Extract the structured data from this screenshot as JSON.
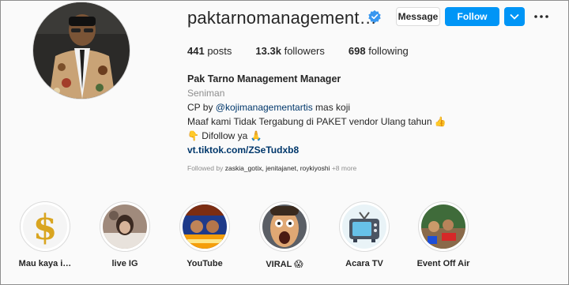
{
  "profile": {
    "username": "paktarnomanagement…",
    "verified_icon": "verified-badge-icon",
    "buttons": {
      "message": "Message",
      "follow": "Follow"
    },
    "stats": {
      "posts_value": "441",
      "posts_label": "posts",
      "followers_value": "13.3k",
      "followers_label": "followers",
      "following_value": "698",
      "following_label": "following"
    },
    "bio": {
      "name": "Pak Tarno Management Manager",
      "category": "Seniman",
      "line1_prefix": "CP by ",
      "line1_mention": "@kojimanagementartis",
      "line1_suffix": " mas koji",
      "line2": "Maaf kami Tidak Tergabung di PAKET vendor Ulang tahun 👍",
      "line3": "👇 Difollow ya 🙏",
      "link": "vt.tiktok.com/ZSeTudxb8"
    },
    "followed_by": {
      "prefix": "Followed by ",
      "users": "zaskia_gotix, jenitajanet, roykiyoshi",
      "suffix": " +8 more"
    }
  },
  "highlights": [
    {
      "label": "Mau kaya i…",
      "icon": "dollar-sign-icon"
    },
    {
      "label": "live IG",
      "icon": "photo-thumb"
    },
    {
      "label": "YouTube",
      "icon": "photo-thumb"
    },
    {
      "label": "VIRAL 😱",
      "icon": "photo-thumb"
    },
    {
      "label": "Acara TV",
      "icon": "tv-icon"
    },
    {
      "label": "Event Off Air",
      "icon": "photo-thumb"
    }
  ],
  "colors": {
    "accent": "#0095f6",
    "link": "#00376b",
    "muted": "#8e8e8e"
  }
}
